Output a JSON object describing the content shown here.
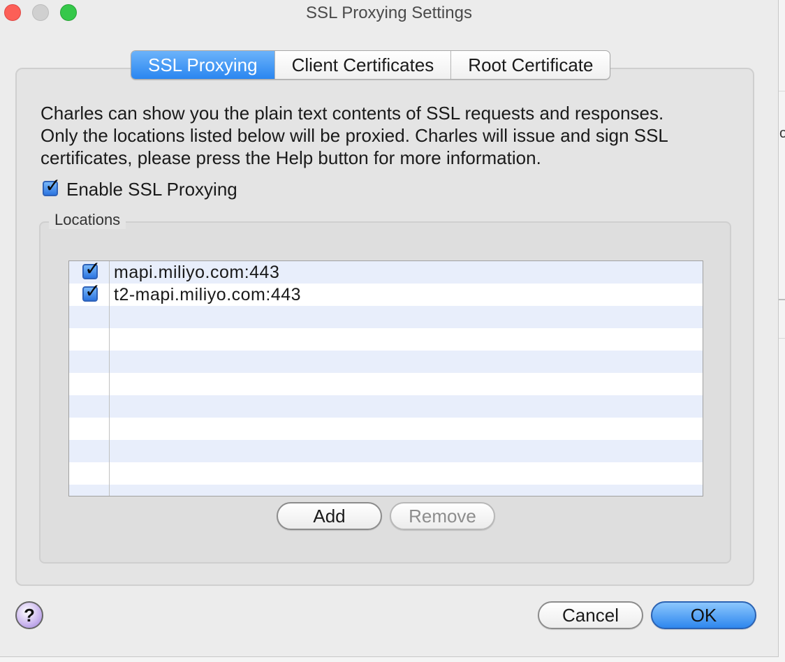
{
  "window": {
    "title": "SSL Proxying Settings"
  },
  "tabs": [
    {
      "label": "SSL Proxying",
      "active": true
    },
    {
      "label": "Client Certificates",
      "active": false
    },
    {
      "label": "Root Certificate",
      "active": false
    }
  ],
  "ssl_proxying": {
    "description_line1": "Charles can show you the plain text contents of SSL requests and responses.",
    "description_line2": "Only the locations listed below will be proxied. Charles will issue and sign SSL",
    "description_line3": "certificates, please press the Help button for more information.",
    "enable_label": "Enable SSL Proxying",
    "enable_checked": true,
    "locations_label": "Locations",
    "locations": [
      {
        "host": "mapi.miliyo.com:443",
        "enabled": true
      },
      {
        "host": "t2-mapi.miliyo.com:443",
        "enabled": true
      }
    ],
    "add_label": "Add",
    "remove_label": "Remove"
  },
  "footer": {
    "help_label": "?",
    "cancel_label": "Cancel",
    "ok_label": "OK"
  },
  "background_fragment": "o",
  "colors": {
    "accent": "#2a86f0",
    "close": "#fc5f57",
    "maximize": "#35c84a",
    "row_alt": "#e8eefb"
  }
}
